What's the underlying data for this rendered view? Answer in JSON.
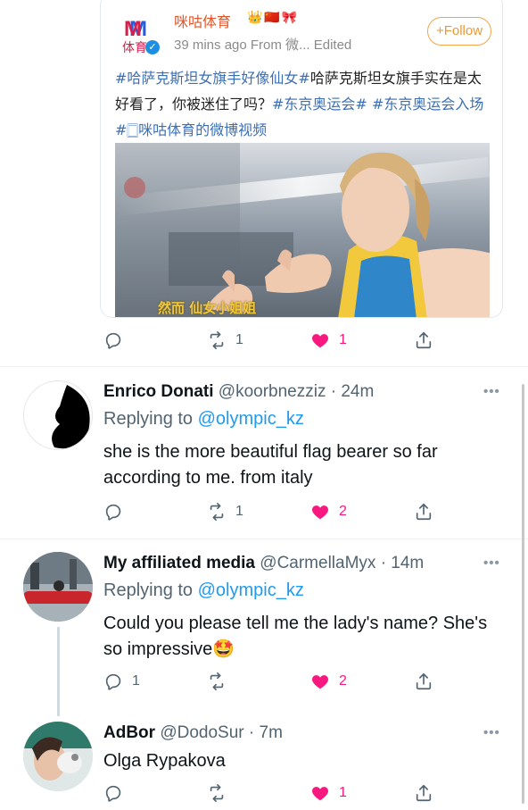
{
  "weibo": {
    "account_name": "咪咕体育",
    "badges": "👑🇨🇳🎀",
    "logo_letter": "M",
    "logo_text": "体育",
    "meta": "39 mins ago  From 微...  Edited",
    "follow_label": "+Follow",
    "text_segments": [
      {
        "text": "#哈萨克斯坦女旗手好像仙女#",
        "tag": true
      },
      {
        "text": "哈萨克斯坦女旗手实在是太好看了，你被迷住了吗？",
        "tag": false
      },
      {
        "text": "#东京奥运会#",
        "tag": true
      },
      {
        "text": " ",
        "tag": false
      },
      {
        "text": "#东京奥运会入场#",
        "tag": true
      },
      {
        "text": "🀆咪咕体育的微博视频",
        "tag": true
      }
    ],
    "image_caption": "然而 仙女小姐姐"
  },
  "main_actions": {
    "reply": "",
    "retweet": "1",
    "like": "1"
  },
  "replies": [
    {
      "name": "Enrico Donati",
      "handle": "@koorbnezziz · 24m",
      "replying_prefix": "Replying to ",
      "replying_to": "@olympic_kz",
      "text": "she is the more beautiful flag bearer so far according to me. from italy",
      "counts": {
        "reply": "",
        "retweet": "1",
        "like": "2"
      }
    },
    {
      "name": "My affiliated media",
      "handle": "@CarmellaMyx · 14m",
      "replying_prefix": "Replying to ",
      "replying_to": "@olympic_kz",
      "text": "Could you please tell me the lady's name? She's so impressive🤩",
      "counts": {
        "reply": "1",
        "retweet": "",
        "like": "2"
      }
    },
    {
      "name": "AdBor",
      "handle": "@DodoSur · 7m",
      "text": "Olga Rypakova",
      "counts": {
        "reply": "",
        "retweet": "",
        "like": "1"
      }
    }
  ],
  "more_label": "•••",
  "colors": {
    "like": "#f91880",
    "link": "#1d9bf0",
    "muted": "#536471",
    "weibo_tag": "#3b6fb6",
    "weibo_name": "#e2562a"
  }
}
